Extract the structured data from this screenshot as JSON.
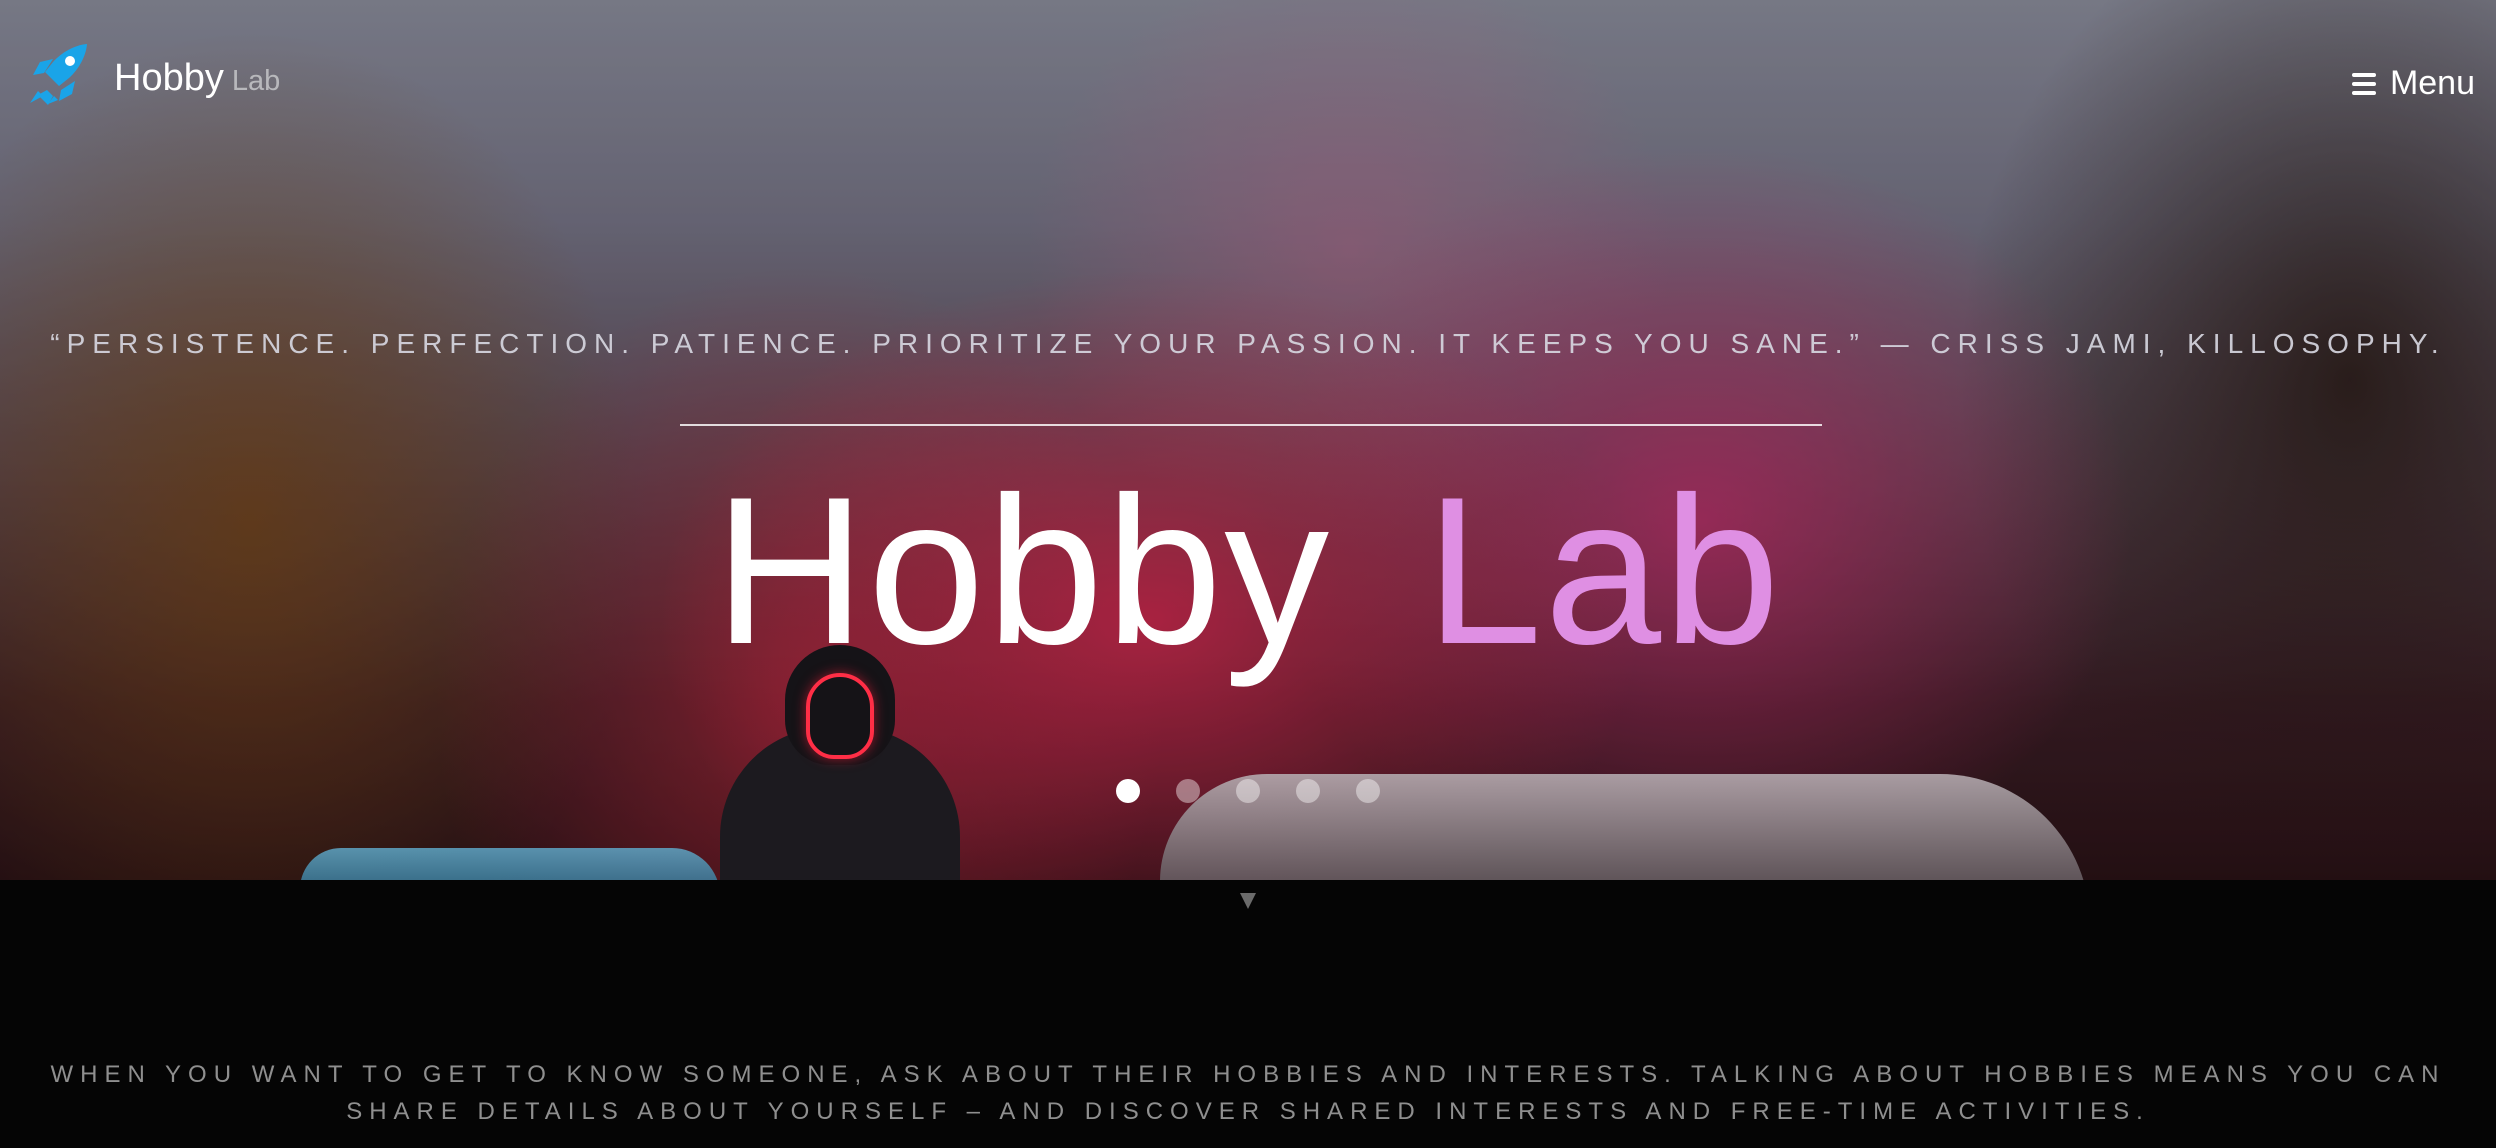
{
  "header": {
    "brand": "Hobby",
    "brand_sub": "Lab",
    "menu_label": "Menu"
  },
  "hero": {
    "quote": "“PERSISTENCE. PERFECTION. PATIENCE. PRIORITIZE YOUR PASSION. IT KEEPS YOU SANE.” — CRISS JAMI, KILLOSOPHY.",
    "title": "Hobby",
    "title_accent": "Lab",
    "slider": {
      "active_index": 1,
      "count": 5
    }
  },
  "content": {
    "intro_line_1": "WHEN YOU WANT TO GET TO KNOW SOMEONE, ASK ABOUT THEIR HOBBIES AND INTERESTS. TALKING ABOUT HOBBIES MEANS YOU CAN",
    "intro_line_2": "SHARE DETAILS ABOUT YOURSELF – AND DISCOVER SHARED INTERESTS AND FREE-TIME ACTIVITIES."
  },
  "icons": {
    "brand": "rocket-icon",
    "menu": "hamburger-menu-icon",
    "scroll": "triangle-down-icon"
  },
  "colors": {
    "brand_icon": "#1aa4e8",
    "accent": "#df8fe3",
    "quote_text": "#d6d6e0",
    "intro_text": "#8f8f8f",
    "background": "#050505"
  }
}
